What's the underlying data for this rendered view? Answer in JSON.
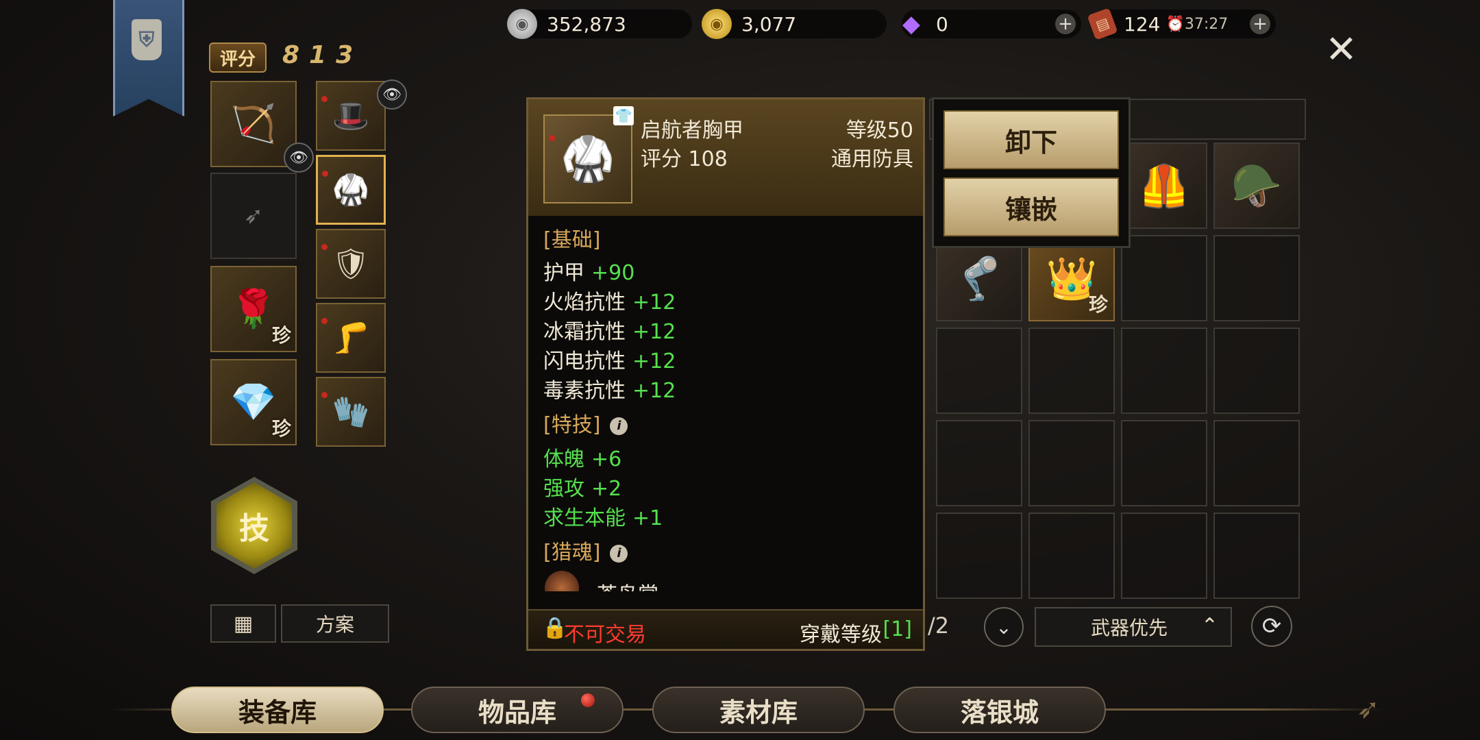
{
  "currency": {
    "silver": {
      "icon": "silver-coin-icon",
      "value": "352,873"
    },
    "gold": {
      "icon": "gold-coin-icon",
      "value": "3,077"
    },
    "diamond": {
      "icon": "diamond-icon",
      "value": "0"
    },
    "stamina": {
      "icon": "stamina-scroll-icon",
      "value": "124",
      "timer": "37:27"
    }
  },
  "score": {
    "label": "评分",
    "value": "813"
  },
  "equipment": {
    "rare_mark": "珍",
    "skill_label": "技",
    "scheme_label": "方案"
  },
  "tooltip": {
    "name": "启航者胸甲",
    "level": "等级50",
    "score": "评分 108",
    "type": "通用防具",
    "basic_title": "[基础]",
    "basic_stats": [
      {
        "name": "护甲",
        "value": "+90"
      },
      {
        "name": "火焰抗性",
        "value": "+12"
      },
      {
        "name": "冰霜抗性",
        "value": "+12"
      },
      {
        "name": "闪电抗性",
        "value": "+12"
      },
      {
        "name": "毒素抗性",
        "value": "+12"
      }
    ],
    "special_title": "[特技]",
    "special_stats": [
      {
        "name": "体魄",
        "value": "+6"
      },
      {
        "name": "强攻",
        "value": "+2"
      },
      {
        "name": "求生本能",
        "value": "+1"
      }
    ],
    "soul_title": "[猎魂]",
    "soul_partial": "苍鸟掌",
    "untradable": "不可交易",
    "wear_level_label": "穿戴等级",
    "wear_level_value": "[1]"
  },
  "actions": {
    "unequip": "卸下",
    "inlay": "镶嵌"
  },
  "inventory": {
    "page_suffix": "/2",
    "sort_label": "武器优先"
  },
  "tabs": [
    "装备库",
    "物品库",
    "素材库",
    "落银城"
  ]
}
